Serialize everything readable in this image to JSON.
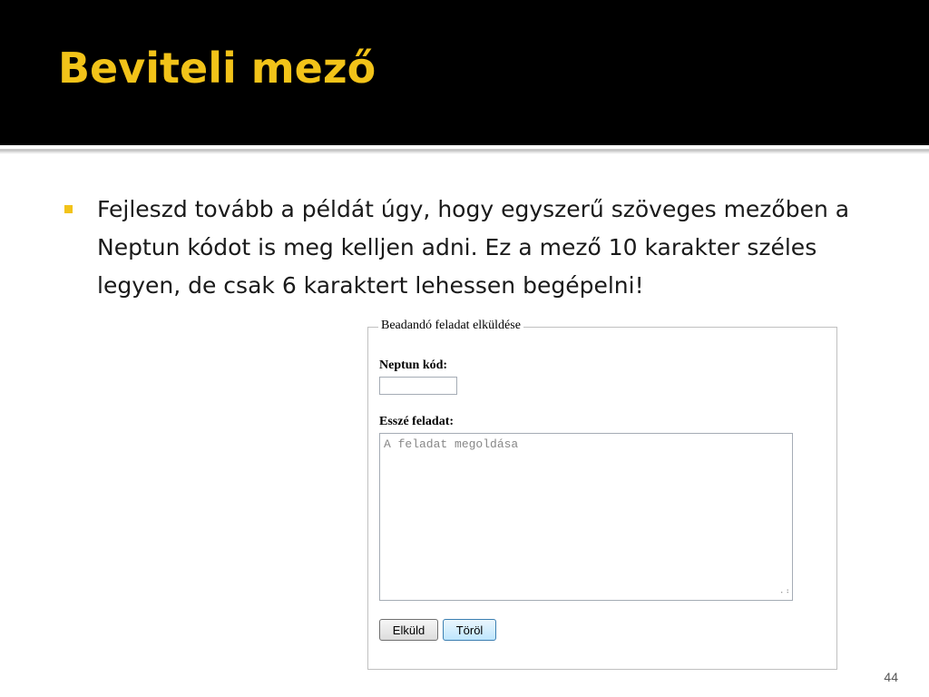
{
  "slide": {
    "title": "Beviteli mező",
    "bullet": "Fejleszd tovább a példát úgy, hogy egyszerű szöveges mezőben a Neptun kódot is meg kelljen adni. Ez a mező 10 karakter széles legyen, de csak 6 karaktert lehessen begépelni!",
    "page_number": "44"
  },
  "form": {
    "legend": "Beadandó feladat elküldése",
    "neptun_label": "Neptun kód:",
    "neptun_value": "",
    "essay_label": "Esszé feladat:",
    "essay_placeholder": "A feladat megoldása",
    "submit_label": "Elküld",
    "reset_label": "Töröl"
  },
  "colors": {
    "title_band": "#000000",
    "title_text": "#f2c319",
    "bullet_marker": "#f2c319"
  }
}
